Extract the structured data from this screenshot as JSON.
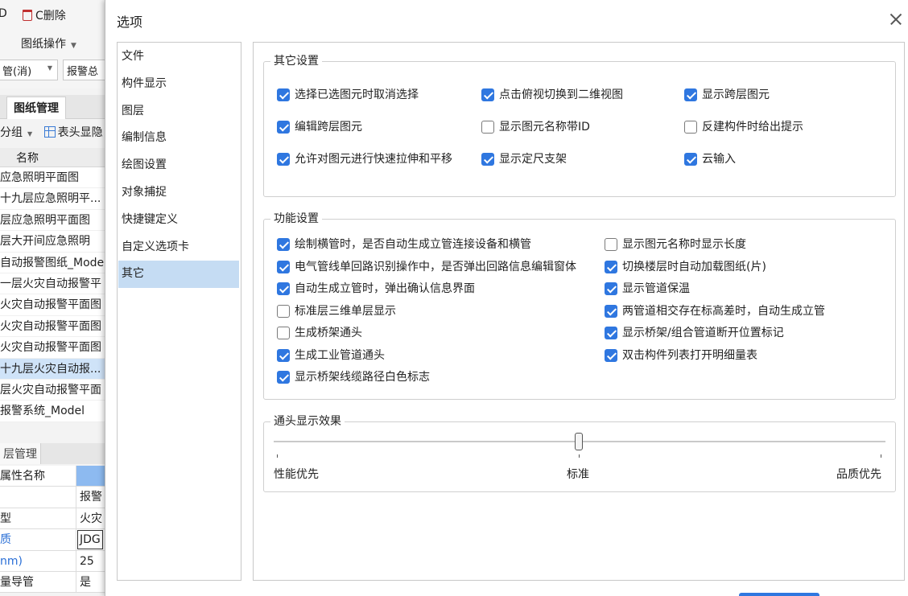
{
  "background": {
    "toolbar": {
      "delete_label": "C删除",
      "drawing_ops_label": "图纸操作",
      "combo1_value": "管(消)",
      "combo2_value": "报警总"
    },
    "drawing_tab": "图纸管理",
    "group_label": "分组",
    "header_display_label": "表头显隐",
    "list_header": "名称",
    "drawings": [
      "应急照明平面图",
      "十九层应急照明平...",
      "层应急照明平面图",
      "层大开间应急照明",
      "自动报警图纸_Mode",
      "一层火灾自动报警平",
      "火灾自动报警平面图",
      "火灾自动报警平面图",
      "火灾自动报警平面图",
      "十九层火灾自动报...",
      "层火灾自动报警平面",
      "报警系统_Model"
    ],
    "layer_tab": "层管理",
    "props": [
      {
        "name": "属性名称",
        "value": ""
      },
      {
        "name": "",
        "value": "报警"
      },
      {
        "name": "型",
        "value": "火灾"
      },
      {
        "name": "质",
        "value": "JDG"
      },
      {
        "name": "nm)",
        "value": "25"
      },
      {
        "name": "量导管",
        "value": "是"
      }
    ]
  },
  "dialog": {
    "title": "选项",
    "nav": [
      "文件",
      "构件显示",
      "图层",
      "编制信息",
      "绘图设置",
      "对象捕捉",
      "快捷键定义",
      "自定义选项卡",
      "其它"
    ],
    "active_nav": "其它",
    "other_settings": {
      "legend": "其它设置",
      "items": [
        {
          "label": "选择已选图元时取消选择",
          "checked": true
        },
        {
          "label": "点击俯视切换到二维视图",
          "checked": true
        },
        {
          "label": "显示跨层图元",
          "checked": true
        },
        {
          "label": "编辑跨层图元",
          "checked": true
        },
        {
          "label": "显示图元名称带ID",
          "checked": false
        },
        {
          "label": "反建构件时给出提示",
          "checked": false
        },
        {
          "label": "允许对图元进行快速拉伸和平移",
          "checked": true
        },
        {
          "label": "显示定尺支架",
          "checked": true
        },
        {
          "label": "云输入",
          "checked": true
        }
      ]
    },
    "function_settings": {
      "legend": "功能设置",
      "left": [
        {
          "label": "绘制横管时，是否自动生成立管连接设备和横管",
          "checked": true
        },
        {
          "label": "电气管线单回路识别操作中，是否弹出回路信息编辑窗体",
          "checked": true
        },
        {
          "label": "自动生成立管时，弹出确认信息界面",
          "checked": true
        },
        {
          "label": "标准层三维单层显示",
          "checked": false
        },
        {
          "label": "生成桥架通头",
          "checked": false
        },
        {
          "label": "生成工业管道通头",
          "checked": true
        },
        {
          "label": "显示桥架线缆路径白色标志",
          "checked": true
        }
      ],
      "right": [
        {
          "label": "显示图元名称时显示长度",
          "checked": false
        },
        {
          "label": "切换楼层时自动加载图纸(片)",
          "checked": true
        },
        {
          "label": "显示管道保温",
          "checked": true
        },
        {
          "label": "两管道相交存在标高差时，自动生成立管",
          "checked": true
        },
        {
          "label": "显示桥架/组合管道断开位置标记",
          "checked": true
        },
        {
          "label": "双击构件列表打开明细量表",
          "checked": true
        }
      ]
    },
    "fitting_effect": {
      "legend": "通头显示效果",
      "labels": [
        "性能优先",
        "标准",
        "品质优先"
      ],
      "value": "标准",
      "position": 0.5
    }
  }
}
